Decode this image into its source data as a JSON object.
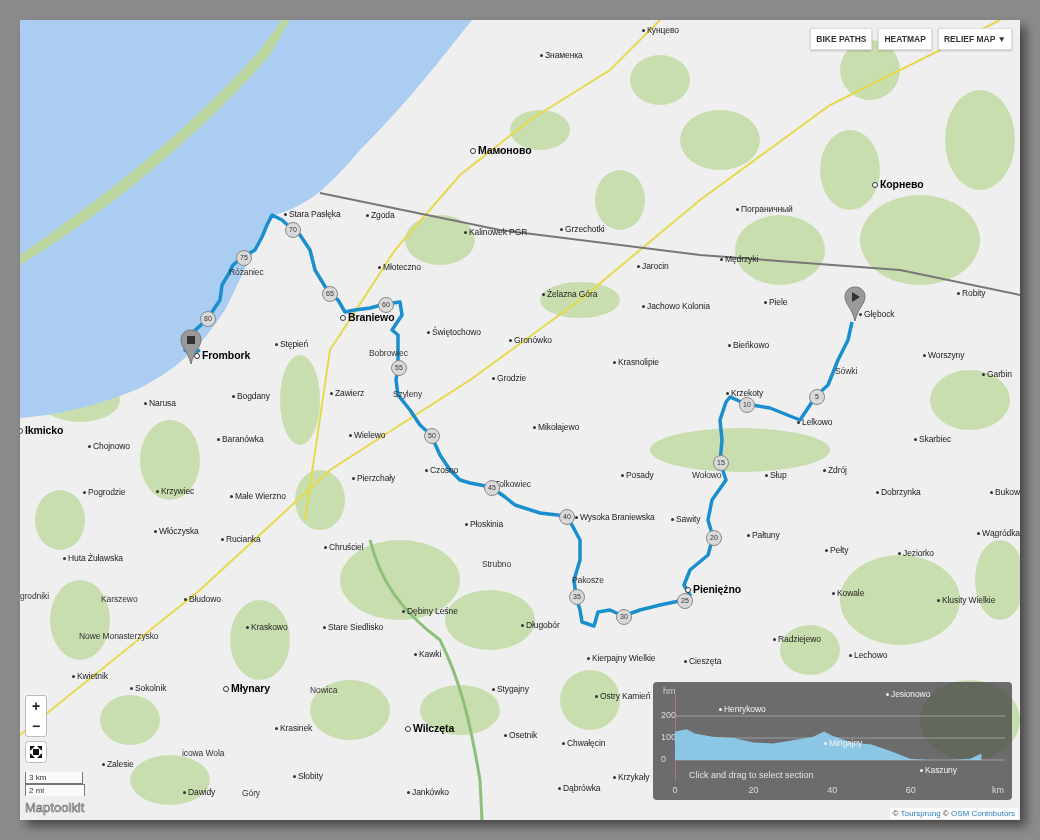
{
  "map_buttons": [
    {
      "label": "BIKE PATHS"
    },
    {
      "label": "HEATMAP"
    },
    {
      "label": "RELIEF MAP ▼"
    }
  ],
  "places": [
    {
      "name": "Кунцево",
      "kind": "village"
    },
    {
      "name": "Знаменка",
      "kind": "village"
    },
    {
      "name": "Мамоново",
      "kind": "town"
    },
    {
      "name": "Корнево",
      "kind": "town"
    },
    {
      "name": "Пограничный",
      "kind": "village"
    },
    {
      "name": "Stara Pasłęka",
      "kind": "village"
    },
    {
      "name": "Zgoda",
      "kind": "village"
    },
    {
      "name": "Grzechotki",
      "kind": "village"
    },
    {
      "name": "Kalinowek PGR",
      "kind": "village"
    },
    {
      "name": "Mędrzyki",
      "kind": "village"
    },
    {
      "name": "Jarocin",
      "kind": "village"
    },
    {
      "name": "Młoteczno",
      "kind": "village"
    },
    {
      "name": "Różaniec",
      "kind": "locality"
    },
    {
      "name": "Żelazna Góra",
      "kind": "village"
    },
    {
      "name": "Robity",
      "kind": "village"
    },
    {
      "name": "Piele",
      "kind": "village"
    },
    {
      "name": "Jachowo Kolonia",
      "kind": "village"
    },
    {
      "name": "Braniewo",
      "kind": "town"
    },
    {
      "name": "Głębock",
      "kind": "village"
    },
    {
      "name": "Świętochowo",
      "kind": "village"
    },
    {
      "name": "Gronówko",
      "kind": "village"
    },
    {
      "name": "Frombork",
      "kind": "town"
    },
    {
      "name": "Stępień",
      "kind": "village"
    },
    {
      "name": "Bieńkowo",
      "kind": "village"
    },
    {
      "name": "Bobrowiec",
      "kind": "locality"
    },
    {
      "name": "Krasnolipie",
      "kind": "village"
    },
    {
      "name": "Worszyny",
      "kind": "village"
    },
    {
      "name": "Sówki",
      "kind": "locality"
    },
    {
      "name": "Grodzie",
      "kind": "village"
    },
    {
      "name": "Garbin",
      "kind": "village"
    },
    {
      "name": "Narusa",
      "kind": "village"
    },
    {
      "name": "Zawierz",
      "kind": "village"
    },
    {
      "name": "Bogdany",
      "kind": "village"
    },
    {
      "name": "Szyleny",
      "kind": "locality"
    },
    {
      "name": "Krzekoty",
      "kind": "village"
    },
    {
      "name": "Lelkowo",
      "kind": "village"
    },
    {
      "name": "lkmicko",
      "kind": "town"
    },
    {
      "name": "Mikołajewo",
      "kind": "village"
    },
    {
      "name": "Wielewo",
      "kind": "village"
    },
    {
      "name": "Skarbiec",
      "kind": "village"
    },
    {
      "name": "Chojnowo",
      "kind": "village"
    },
    {
      "name": "Baranówka",
      "kind": "village"
    },
    {
      "name": "Czosno",
      "kind": "village"
    },
    {
      "name": "Tolkowiec",
      "kind": "locality"
    },
    {
      "name": "Pierzchały",
      "kind": "village"
    },
    {
      "name": "Posady",
      "kind": "village"
    },
    {
      "name": "Wołowo",
      "kind": "locality"
    },
    {
      "name": "Słup",
      "kind": "village"
    },
    {
      "name": "Zdrój",
      "kind": "village"
    },
    {
      "name": "Pogrodzie",
      "kind": "village"
    },
    {
      "name": "Krzywiec",
      "kind": "village"
    },
    {
      "name": "Małe Wierzno",
      "kind": "village"
    },
    {
      "name": "Dobrzynka",
      "kind": "village"
    },
    {
      "name": "Bukow",
      "kind": "village"
    },
    {
      "name": "Wysoka Braniewska",
      "kind": "village"
    },
    {
      "name": "Sawity",
      "kind": "village"
    },
    {
      "name": "Płoskinia",
      "kind": "village"
    },
    {
      "name": "Włóczyska",
      "kind": "village"
    },
    {
      "name": "Rucianka",
      "kind": "village"
    },
    {
      "name": "Pałtuny",
      "kind": "village"
    },
    {
      "name": "Wągródka",
      "kind": "village"
    },
    {
      "name": "Chruściel",
      "kind": "village"
    },
    {
      "name": "Pełty",
      "kind": "village"
    },
    {
      "name": "Jeziorko",
      "kind": "village"
    },
    {
      "name": "Huta Żuławska",
      "kind": "village"
    },
    {
      "name": "Strubno",
      "kind": "locality"
    },
    {
      "name": "Pakosze",
      "kind": "locality"
    },
    {
      "name": "Pieniężno",
      "kind": "town"
    },
    {
      "name": "Kowale",
      "kind": "village"
    },
    {
      "name": "Klusity Wielkie",
      "kind": "village"
    },
    {
      "name": "grodniki",
      "kind": "locality"
    },
    {
      "name": "Karszewo",
      "kind": "locality"
    },
    {
      "name": "Błudowo",
      "kind": "village"
    },
    {
      "name": "Dębiny Leśne",
      "kind": "village"
    },
    {
      "name": "Kraskowo",
      "kind": "village"
    },
    {
      "name": "Stare Siedlisko",
      "kind": "village"
    },
    {
      "name": "Długobór",
      "kind": "village"
    },
    {
      "name": "Nowe Monasterzysko",
      "kind": "locality"
    },
    {
      "name": "Radziejewo",
      "kind": "village"
    },
    {
      "name": "Kawki",
      "kind": "village"
    },
    {
      "name": "Lechowo",
      "kind": "village"
    },
    {
      "name": "Kierpajny Wielkie",
      "kind": "village"
    },
    {
      "name": "Cieszęta",
      "kind": "village"
    },
    {
      "name": "Kwietnik",
      "kind": "village"
    },
    {
      "name": "Sokolnik",
      "kind": "village"
    },
    {
      "name": "Młynary",
      "kind": "town"
    },
    {
      "name": "Nowica",
      "kind": "locality"
    },
    {
      "name": "Stygajny",
      "kind": "village"
    },
    {
      "name": "Ostry Kamień",
      "kind": "village"
    },
    {
      "name": "Krasinek",
      "kind": "village"
    },
    {
      "name": "Wilczęta",
      "kind": "town"
    },
    {
      "name": "Osetnik",
      "kind": "village"
    },
    {
      "name": "Chwałęcin",
      "kind": "village"
    },
    {
      "name": "icowa Wola",
      "kind": "locality"
    },
    {
      "name": "Zalesie",
      "kind": "village"
    },
    {
      "name": "Słobity",
      "kind": "village"
    },
    {
      "name": "Dawidy",
      "kind": "village"
    },
    {
      "name": "Góry",
      "kind": "locality"
    },
    {
      "name": "Jankówko",
      "kind": "village"
    },
    {
      "name": "Dąbrówka",
      "kind": "village"
    },
    {
      "name": "Henrykowo",
      "kind": "village"
    },
    {
      "name": "Jesionowo",
      "kind": "village"
    },
    {
      "name": "Mingajny",
      "kind": "village"
    },
    {
      "name": "Kaszuny",
      "kind": "village"
    },
    {
      "name": "Krzykały",
      "kind": "village"
    }
  ],
  "distance_markers": [
    "5",
    "10",
    "15",
    "20",
    "25",
    "30",
    "35",
    "40",
    "45",
    "50",
    "55",
    "60",
    "65",
    "70",
    "75",
    "80"
  ],
  "zoom_controls": [
    "+",
    "−"
  ],
  "scale": [
    "3 km",
    "2 mi"
  ],
  "logo": "Maptoolkit",
  "elevation_profile": {
    "hint": "Click and drag to select section",
    "chart_data": {
      "type": "area",
      "xlabel": "km",
      "ylabel": "hm",
      "x": [
        0,
        3,
        5,
        10,
        15,
        20,
        25,
        30,
        35,
        38,
        40,
        45,
        50,
        55,
        60,
        65,
        70,
        75,
        78
      ],
      "values": [
        130,
        140,
        120,
        105,
        100,
        80,
        75,
        90,
        105,
        130,
        110,
        80,
        70,
        40,
        5,
        0,
        0,
        5,
        30
      ],
      "xlim": [
        0,
        84
      ],
      "ylim": [
        -100,
        300
      ],
      "xticks": [
        0,
        20,
        40,
        60
      ],
      "yticks": [
        0,
        100,
        200
      ],
      "grid": true
    }
  },
  "attribution": {
    "sign": "©",
    "provider": "Toursprung",
    "sign_2": "©",
    "osm": "OSM Contributors"
  }
}
